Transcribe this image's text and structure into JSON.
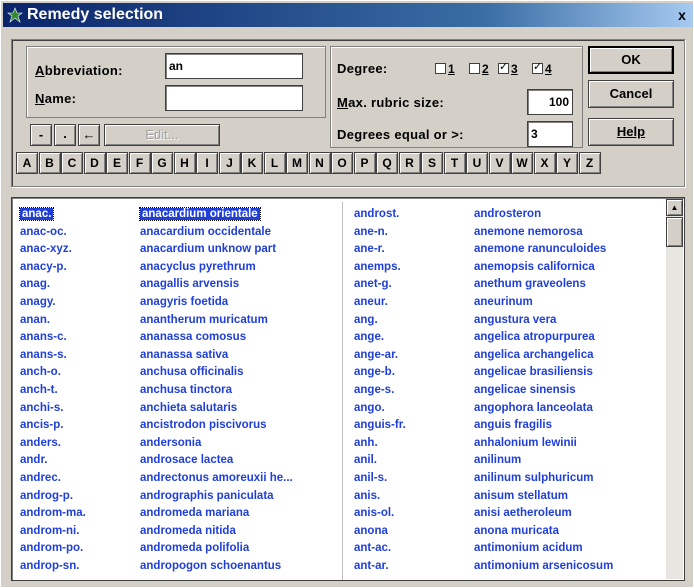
{
  "window": {
    "title": "Remedy selection",
    "close": "x"
  },
  "fields": {
    "abbreviation_label_pre": "",
    "abbreviation_label_u": "A",
    "abbreviation_label_post": "bbreviation:",
    "abbreviation_value": "an",
    "name_label_u": "N",
    "name_label_post": "ame:",
    "name_value": ""
  },
  "degree": {
    "label": "Degree:",
    "options": [
      {
        "num": "1",
        "checked": false
      },
      {
        "num": "2",
        "checked": false
      },
      {
        "num": "3",
        "checked": true
      },
      {
        "num": "4",
        "checked": true
      }
    ],
    "max_rubric_label_u": "M",
    "max_rubric_label_post": "ax. rubric size:",
    "max_rubric_value": "100",
    "degrees_equal_label": "Degrees equal or >:",
    "degrees_equal_value": "3"
  },
  "buttons": {
    "ok": "OK",
    "cancel": "Cancel",
    "help": "Help",
    "edit": "Edit...",
    "minus": "-",
    "dot": ".",
    "back": "←"
  },
  "letters": [
    "A",
    "B",
    "C",
    "D",
    "E",
    "F",
    "G",
    "H",
    "I",
    "J",
    "K",
    "L",
    "M",
    "N",
    "O",
    "P",
    "Q",
    "R",
    "S",
    "T",
    "U",
    "V",
    "W",
    "X",
    "Y",
    "Z"
  ],
  "list_left": [
    [
      "anac.",
      "anacardium orientale"
    ],
    [
      "anac-oc.",
      "anacardium occidentale"
    ],
    [
      "anac-xyz.",
      "anacardium unknow part"
    ],
    [
      "anacy-p.",
      "anacyclus pyrethrum"
    ],
    [
      "anag.",
      "anagallis arvensis"
    ],
    [
      "anagy.",
      "anagyris foetida"
    ],
    [
      "anan.",
      "anantherum muricatum"
    ],
    [
      "anans-c.",
      "ananassa comosus"
    ],
    [
      "anans-s.",
      "ananassa sativa"
    ],
    [
      "anch-o.",
      "anchusa officinalis"
    ],
    [
      "anch-t.",
      "anchusa tinctora"
    ],
    [
      "anchi-s.",
      "anchieta salutaris"
    ],
    [
      "ancis-p.",
      "ancistrodon piscivorus"
    ],
    [
      "anders.",
      "andersonia"
    ],
    [
      "andr.",
      "androsace lactea"
    ],
    [
      "andrec.",
      "andrectonus amoreuxii he..."
    ],
    [
      "androg-p.",
      "andrographis paniculata"
    ],
    [
      "androm-ma.",
      "andromeda mariana"
    ],
    [
      "androm-ni.",
      "andromeda nitida"
    ],
    [
      "androm-po.",
      "andromeda polifolia"
    ],
    [
      "androp-sn.",
      "andropogon schoenantus"
    ]
  ],
  "list_right": [
    [
      "androst.",
      "androsteron"
    ],
    [
      "ane-n.",
      "anemone nemorosa"
    ],
    [
      "ane-r.",
      "anemone ranunculoides"
    ],
    [
      "anemps.",
      "anemopsis californica"
    ],
    [
      "anet-g.",
      "anethum graveolens"
    ],
    [
      "aneur.",
      "aneurinum"
    ],
    [
      "ang.",
      "angustura vera"
    ],
    [
      "ange.",
      "angelica atropurpurea"
    ],
    [
      "ange-ar.",
      "angelica archangelica"
    ],
    [
      "ange-b.",
      "angelicae brasiliensis"
    ],
    [
      "ange-s.",
      "angelicae sinensis"
    ],
    [
      "ango.",
      "angophora lanceolata"
    ],
    [
      "anguis-fr.",
      "anguis fragilis"
    ],
    [
      "anh.",
      "anhalonium lewinii"
    ],
    [
      "anil.",
      "anilinum"
    ],
    [
      "anil-s.",
      "anilinum sulphuricum"
    ],
    [
      "anis.",
      "anisum stellatum"
    ],
    [
      "anis-ol.",
      "anisi aetheroleum"
    ],
    [
      "anona",
      "anona muricata"
    ],
    [
      "ant-ac.",
      "antimonium acidum"
    ],
    [
      "ant-ar.",
      "antimonium arsenicosum"
    ]
  ],
  "selected_index": 0,
  "colors": {
    "link": "#1f3fd8",
    "title_start": "#0a246a",
    "title_end": "#a6caf0"
  }
}
